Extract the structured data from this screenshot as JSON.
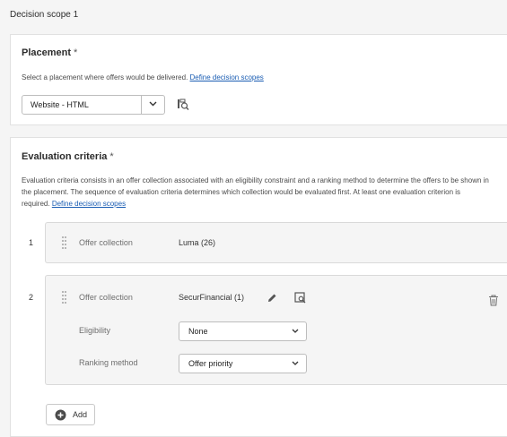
{
  "scope_title": "Decision scope 1",
  "placement": {
    "title": "Placement",
    "required_mark": "*",
    "description": "Select a placement where offers would be delivered.",
    "link": "Define decision scopes",
    "selected": "Website - HTML"
  },
  "evaluation": {
    "title": "Evaluation criteria",
    "required_mark": "*",
    "description_line1": "Evaluation criteria consists in an offer collection associated with an eligibility constraint and a ranking method to determine the offers to be shown in",
    "description_line2": "the placement. The sequence of evaluation criteria determines which collection would be evaluated first. At least one evaluation criterion is",
    "description_line3": "required.",
    "link": "Define decision scopes",
    "criteria": [
      {
        "number": "1",
        "collection_label": "Offer collection",
        "collection_value": "Luma (26)"
      },
      {
        "number": "2",
        "collection_label": "Offer collection",
        "collection_value": "SecurFinancial (1)",
        "eligibility_label": "Eligibility",
        "eligibility_value": "None",
        "ranking_label": "Ranking method",
        "ranking_value": "Offer priority"
      }
    ],
    "add_label": "Add"
  },
  "icons": {
    "chevron": "chevron-down-icon",
    "browse": "browse-collection-icon",
    "grip": "drag-handle-icon",
    "edit": "pencil-icon",
    "delete": "trash-icon",
    "add": "add-circle-icon"
  },
  "colors": {
    "link": "#1a5db3",
    "card_bg": "#ffffff",
    "page_bg": "#f5f5f5",
    "row_bg": "#f5f5f5"
  }
}
